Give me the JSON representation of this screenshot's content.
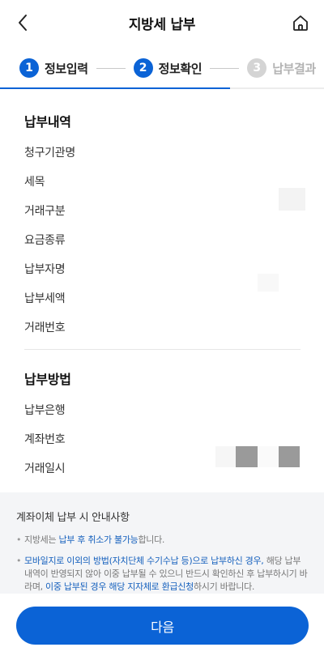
{
  "header": {
    "title": "지방세 납부",
    "back_icon": "chevron-left-icon",
    "home_icon": "home-icon"
  },
  "steps": [
    {
      "num": "1",
      "label": "정보입력",
      "state": "done"
    },
    {
      "num": "2",
      "label": "정보확인",
      "state": "current"
    },
    {
      "num": "3",
      "label": "납부결과",
      "state": "pending"
    }
  ],
  "progress": {
    "percent": 71
  },
  "payment_details": {
    "title": "납부내역",
    "rows": [
      "청구기관명",
      "세목",
      "거래구분",
      "요금종류",
      "납부자명",
      "납부세액",
      "거래번호"
    ]
  },
  "payment_method": {
    "title": "납부방법",
    "rows": [
      "납부은행",
      "계좌번호",
      "거래일시"
    ]
  },
  "notice": {
    "title": "계좌이체 납부 시 안내사항",
    "item1": {
      "a": "지방세는 ",
      "b": "납부 후 취소가 불가능",
      "c": "합니다."
    },
    "item2": {
      "a": "모바일지로 이외의 방법(자치단체 수기수납 등)으로 납부하신 경우,",
      "b": " 해당 납부내역이 반영되지 않아 이중 납부될 수 있으니 반드시 확인하신 후 납부하시기 바라며, ",
      "c": "이중 납부된 경우 해당 지자체로 환급신청",
      "d": "하시기 바랍니다."
    }
  },
  "next_button": {
    "label": "다음"
  },
  "colors": {
    "primary": "#0b63d6",
    "link": "#1560bd",
    "notice_bg": "#f4f5f7"
  }
}
